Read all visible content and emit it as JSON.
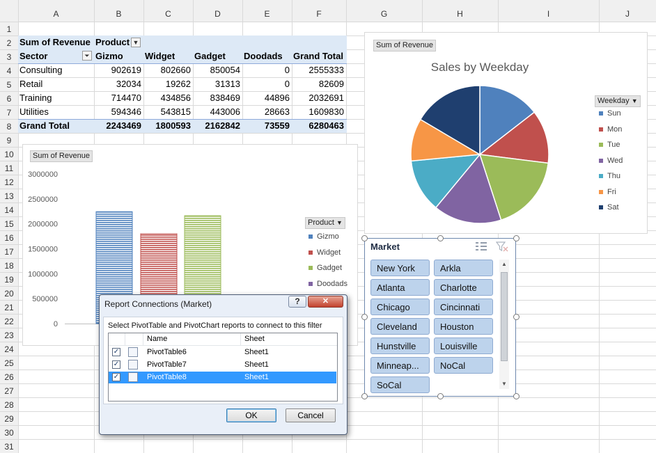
{
  "grid": {
    "columns": [
      "A",
      "B",
      "C",
      "D",
      "E",
      "F",
      "G",
      "H",
      "I",
      "J"
    ],
    "rows": [
      "1",
      "2",
      "3",
      "4",
      "5",
      "6",
      "7",
      "8",
      "9",
      "10",
      "11",
      "12",
      "13",
      "14",
      "15",
      "16",
      "17",
      "18",
      "19",
      "20",
      "21",
      "22",
      "23",
      "24",
      "25",
      "26",
      "27",
      "28",
      "29",
      "30",
      "31"
    ]
  },
  "pivot": {
    "sum_label": "Sum of Revenue",
    "product_label": "Product",
    "sector_label": "Sector",
    "col_headers": [
      "Gizmo",
      "Widget",
      "Gadget",
      "Doodads",
      "Grand Total"
    ],
    "rows": [
      {
        "name": "Consulting",
        "values": [
          "902619",
          "802660",
          "850054",
          "0",
          "2555333"
        ]
      },
      {
        "name": "Retail",
        "values": [
          "32034",
          "19262",
          "31313",
          "0",
          "82609"
        ]
      },
      {
        "name": "Training",
        "values": [
          "714470",
          "434856",
          "838469",
          "44896",
          "2032691"
        ]
      },
      {
        "name": "Utilities",
        "values": [
          "594346",
          "543815",
          "443006",
          "28663",
          "1609830"
        ]
      }
    ],
    "grand_total": {
      "name": "Grand Total",
      "values": [
        "2243469",
        "1800593",
        "2162842",
        "73559",
        "6280463"
      ]
    },
    "header_fill": "#dde9f6",
    "total_fill": "#dde9f6"
  },
  "chart_data": [
    {
      "type": "pie",
      "title": "Sales by Weekday",
      "field_button": "Sum of Revenue",
      "legend_button": "Weekday",
      "legend_position": "right",
      "categories": [
        "Sun",
        "Mon",
        "Tue",
        "Wed",
        "Thu",
        "Fri",
        "Sat"
      ],
      "values": [
        14.5,
        12.5,
        18,
        16,
        12.5,
        10,
        16.5
      ],
      "colors": [
        "#4f81bd",
        "#c0504d",
        "#9bbb59",
        "#8064a2",
        "#4bacc6",
        "#f79646",
        "#1f3f6f"
      ]
    },
    {
      "type": "bar",
      "field_button": "Sum of Revenue",
      "legend_button": "Product",
      "legend_position": "right",
      "categories": [
        "Gizmo",
        "Widget",
        "Gadget",
        "Doodads"
      ],
      "series": [
        {
          "name": "Gizmo",
          "values": [
            2243469
          ]
        },
        {
          "name": "Widget",
          "values": [
            1800593
          ]
        },
        {
          "name": "Gadget",
          "values": [
            2162842
          ]
        },
        {
          "name": "Doodads",
          "values": [
            73559
          ]
        }
      ],
      "colors": [
        "#4f81bd",
        "#c0504d",
        "#9bbb59",
        "#8064a2"
      ],
      "ylim": [
        0,
        3000000
      ],
      "yticks": [
        "3000000",
        "2500000",
        "2000000",
        "1500000",
        "1000000",
        "500000",
        "0"
      ]
    }
  ],
  "slicer": {
    "title": "Market",
    "items": [
      "New York",
      "Arkla",
      "Atlanta",
      "Charlotte",
      "Chicago",
      "Cincinnati",
      "Cleveland",
      "Houston",
      "Hunstville",
      "Louisville",
      "Minneap...",
      "NoCal",
      "SoCal"
    ],
    "item_fill": "#bdd3ec"
  },
  "dialog": {
    "title": "Report Connections (Market)",
    "help": "?",
    "close": "✕",
    "instruction": "Select PivotTable and PivotChart reports to connect to this filter",
    "col_name": "Name",
    "col_sheet": "Sheet",
    "items": [
      {
        "name": "PivotTable6",
        "sheet": "Sheet1",
        "checked": true
      },
      {
        "name": "PivotTable7",
        "sheet": "Sheet1",
        "checked": true
      },
      {
        "name": "PivotTable8",
        "sheet": "Sheet1",
        "checked": true
      }
    ],
    "ok": "OK",
    "cancel": "Cancel",
    "selected_fill": "#3399ff"
  }
}
